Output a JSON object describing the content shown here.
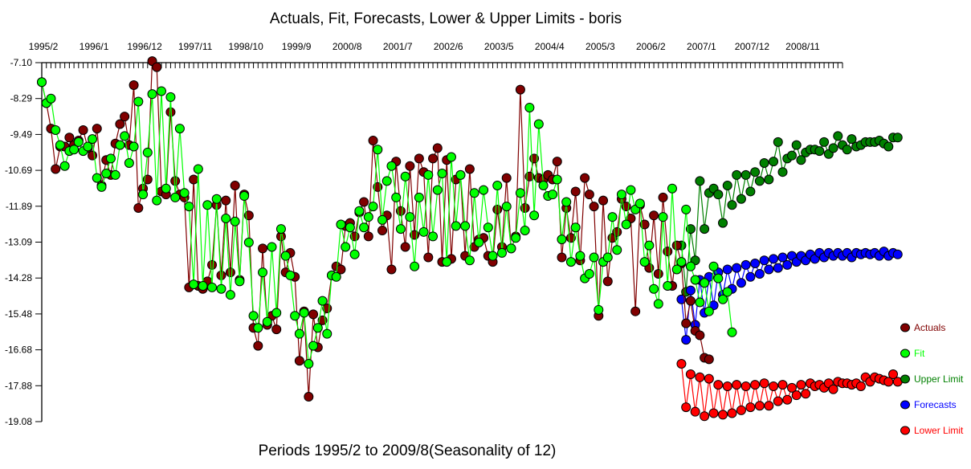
{
  "chart_data": {
    "type": "line",
    "title": "Actuals, Fit, Forecasts, Lower & Upper Limits - boris",
    "xlabel": "Periods 1995/2 to 2009/8(Seasonality of 12)",
    "ylabel": "",
    "start_period": "1995/2",
    "end_period": "2009/8",
    "n_periods": 175,
    "seasonality": 12,
    "x_tick_labels": [
      "1995/2",
      "1996/1",
      "1996/12",
      "1997/11",
      "1998/10",
      "1999/9",
      "2000/8",
      "2001/7",
      "2002/6",
      "2003/5",
      "2004/4",
      "2005/3",
      "2006/2",
      "2007/1",
      "2007/12",
      "2008/11"
    ],
    "x_tick_label_every": 11,
    "y_tick_labels": [
      "-7.10",
      "-8.29",
      "-9.49",
      "-10.69",
      "-11.89",
      "-13.09",
      "-14.28",
      "-15.48",
      "-16.68",
      "-17.88",
      "-19.08"
    ],
    "ylim": [
      -19.08,
      -7.1
    ],
    "grid": false,
    "legend_position": "right",
    "series": [
      {
        "name": "Actuals",
        "color": "#800000",
        "start_index": 0,
        "values": [
          -7.75,
          -8.45,
          -9.3,
          -10.65,
          -9.9,
          -9.9,
          -9.6,
          -9.85,
          -9.7,
          -9.35,
          -9.95,
          -10.2,
          -9.3,
          -11.2,
          -10.35,
          -10.85,
          -9.8,
          -9.15,
          -8.9,
          -9.85,
          -7.85,
          -11.95,
          -11.3,
          -11.0,
          -7.05,
          -7.25,
          -11.4,
          -11.5,
          -8.75,
          -11.05,
          -11.5,
          -11.6,
          -14.6,
          -11.0,
          -14.55,
          -14.65,
          -14.4,
          -13.85,
          -11.85,
          -14.2,
          -11.7,
          -14.1,
          -11.2,
          -14.35,
          -11.5,
          -12.2,
          -15.95,
          -16.55,
          -13.3,
          -15.85,
          -15.55,
          -16.0,
          -12.9,
          -14.1,
          -13.45,
          -14.25,
          -17.05,
          -15.4,
          -18.25,
          -15.5,
          -16.6,
          -15.7,
          -15.3,
          -14.2,
          -13.9,
          -14.0,
          -12.55,
          -12.45,
          -12.9,
          -12.1,
          -11.75,
          -12.9,
          -9.7,
          -11.25,
          -12.7,
          -12.2,
          -14.0,
          -10.4,
          -12.05,
          -13.25,
          -10.55,
          -12.85,
          -10.3,
          -10.75,
          -13.6,
          -10.3,
          -9.95,
          -13.75,
          -10.35,
          -13.65,
          -11.0,
          -10.85,
          -13.55,
          -10.65,
          -13.25,
          -13.0,
          -12.95,
          -13.55,
          -13.75,
          -12.0,
          -13.25,
          -10.95,
          -13.3,
          -12.9,
          -8.0,
          -11.95,
          -10.9,
          -10.3,
          -10.95,
          -11.0,
          -10.85,
          -11.0,
          -10.4,
          -13.6,
          -11.95,
          -12.95,
          -11.4,
          -13.7,
          -10.95,
          -11.5,
          -11.9,
          -15.55,
          -11.7,
          -14.4,
          -12.95,
          -12.75,
          -11.65,
          -11.9,
          -12.3,
          -15.4,
          -11.85,
          -12.5,
          -13.95,
          -12.2,
          -14.15,
          -11.6,
          -13.4,
          -14.55,
          -13.2,
          -13.8,
          -15.8,
          -15.05,
          -16.05,
          -16.2,
          -16.95,
          -17.0
        ]
      },
      {
        "name": "Fit",
        "color": "#00ff00",
        "start_index": 0,
        "values": [
          -7.75,
          -8.45,
          -8.3,
          -9.35,
          -9.85,
          -10.55,
          -10.05,
          -10.0,
          -9.75,
          -10.05,
          -9.9,
          -9.65,
          -10.95,
          -11.25,
          -10.8,
          -10.3,
          -10.85,
          -9.85,
          -9.55,
          -10.45,
          -9.9,
          -8.4,
          -11.5,
          -10.1,
          -8.15,
          -11.7,
          -8.05,
          -11.3,
          -8.25,
          -11.6,
          -9.3,
          -11.45,
          -11.9,
          -14.5,
          -10.65,
          -14.55,
          -11.85,
          -14.6,
          -11.65,
          -14.65,
          -12.3,
          -14.85,
          -12.4,
          -14.4,
          -11.55,
          -13.1,
          -15.55,
          -15.95,
          -14.1,
          -15.75,
          -13.25,
          -15.45,
          -12.65,
          -13.55,
          -14.2,
          -15.55,
          -16.15,
          -15.45,
          -17.15,
          -16.55,
          -15.95,
          -15.05,
          -16.15,
          -14.2,
          -14.25,
          -12.5,
          -13.25,
          -12.6,
          -13.5,
          -12.05,
          -12.6,
          -12.25,
          -11.9,
          -10.0,
          -12.35,
          -11.05,
          -10.55,
          -11.6,
          -12.65,
          -10.9,
          -12.25,
          -13.9,
          -11.6,
          -12.75,
          -10.85,
          -12.9,
          -11.35,
          -10.8,
          -13.75,
          -10.25,
          -12.55,
          -10.85,
          -12.55,
          -13.7,
          -11.45,
          -13.1,
          -11.35,
          -12.6,
          -13.55,
          -11.2,
          -13.45,
          -11.9,
          -13.3,
          -12.95,
          -11.45,
          -12.7,
          -8.6,
          -12.2,
          -9.15,
          -11.2,
          -11.55,
          -11.5,
          -11.0,
          -13.0,
          -11.75,
          -13.75,
          -12.6,
          -13.55,
          -14.3,
          -14.15,
          -13.6,
          -15.35,
          -13.75,
          -13.6,
          -12.25,
          -13.35,
          -11.5,
          -12.5,
          -11.35,
          -12.0,
          -11.8,
          -13.75,
          -13.2,
          -14.65,
          -15.15,
          -12.25,
          -14.55,
          -11.3,
          -14.0,
          -13.75,
          -12.0,
          -13.9,
          -14.35,
          -15.1,
          -14.45,
          -15.4,
          -13.9,
          -14.3,
          -15.0,
          -14.75,
          -16.1
        ]
      },
      {
        "name": "Upper Limit",
        "color": "#008000",
        "start_index": 139,
        "values": [
          -13.2,
          -14.75,
          -12.65,
          -13.7,
          -11.05,
          -12.65,
          -11.45,
          -11.3,
          -11.5,
          -12.45,
          -11.2,
          -11.85,
          -10.85,
          -11.65,
          -10.85,
          -11.4,
          -10.75,
          -11.05,
          -10.45,
          -11.0,
          -10.4,
          -9.75,
          -10.75,
          -10.3,
          -10.2,
          -9.85,
          -10.35,
          -10.1,
          -10.0,
          -10.0,
          -10.05,
          -9.75,
          -10.15,
          -9.95,
          -9.55,
          -9.85,
          -10.0,
          -9.65,
          -9.9,
          -9.85,
          -9.75,
          -9.75,
          -9.75,
          -9.7,
          -9.8,
          -9.9,
          -9.6,
          -9.6
        ]
      },
      {
        "name": "Forecasts",
        "color": "#0000ff",
        "start_index": 139,
        "values": [
          -15.0,
          -16.35,
          -14.7,
          -15.85,
          -14.35,
          -15.45,
          -14.25,
          -15.2,
          -14.1,
          -14.85,
          -14.0,
          -14.65,
          -13.95,
          -14.45,
          -13.85,
          -14.25,
          -13.8,
          -14.15,
          -13.7,
          -14.0,
          -13.65,
          -13.95,
          -13.6,
          -13.85,
          -13.55,
          -13.75,
          -13.55,
          -13.7,
          -13.5,
          -13.65,
          -13.45,
          -13.6,
          -13.45,
          -13.55,
          -13.45,
          -13.55,
          -13.45,
          -13.6,
          -13.45,
          -13.5,
          -13.45,
          -13.5,
          -13.45,
          -13.55,
          -13.4,
          -13.55,
          -13.45,
          -13.5
        ]
      },
      {
        "name": "Lower Limit",
        "color": "#ff0000",
        "start_index": 139,
        "values": [
          -17.15,
          -18.6,
          -17.5,
          -18.75,
          -17.6,
          -18.9,
          -17.65,
          -18.8,
          -17.85,
          -18.85,
          -17.9,
          -18.8,
          -17.85,
          -18.7,
          -17.9,
          -18.6,
          -17.85,
          -18.55,
          -17.8,
          -18.55,
          -17.9,
          -18.4,
          -17.85,
          -18.35,
          -17.95,
          -18.2,
          -17.85,
          -18.15,
          -17.8,
          -17.9,
          -17.85,
          -17.95,
          -17.8,
          -18.0,
          -17.75,
          -17.8,
          -17.8,
          -17.85,
          -17.8,
          -17.9,
          -17.6,
          -17.75,
          -17.6,
          -17.65,
          -17.7,
          -17.75,
          -17.5,
          -17.75
        ]
      }
    ]
  }
}
